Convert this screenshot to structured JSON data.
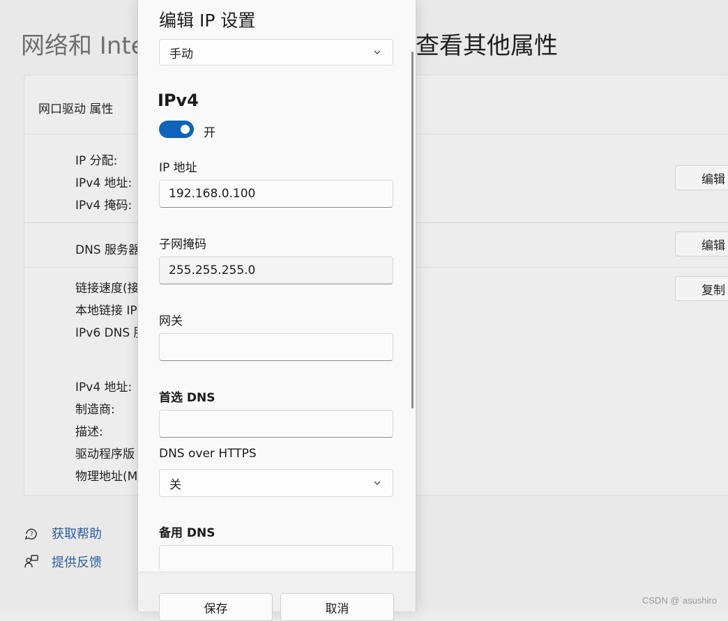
{
  "background": {
    "title_left": "网络和 Inte",
    "title_right": "查看其他属性",
    "card_header": "网口驱动 属性",
    "labels": {
      "ip_assign": "IP 分配:",
      "ipv4_addr": "IPv4 地址:",
      "ipv4_mask": "IPv4 掩码:",
      "dns": "DNS 服务器",
      "link_speed": "链接速度(接",
      "local_link": "本地链接 IP",
      "ipv6_dns": "IPv6 DNS 服",
      "ipv4_addr2": "IPv4 地址:",
      "manufacturer": "制造商:",
      "description": "描述:",
      "driver": "驱动程序版",
      "mac": "物理地址(M"
    },
    "buttons": {
      "edit1": "编辑",
      "edit2": "编辑",
      "copy": "复制"
    },
    "help_link": "获取帮助",
    "feedback_link": "提供反馈",
    "watermark": "CSDN @˙asushiro"
  },
  "dialog": {
    "title": "编辑 IP 设置",
    "mode_select": "手动",
    "ipv4_heading": "IPv4",
    "toggle_label": "开",
    "ip_label": "IP 地址",
    "ip_value": "192.168.0.100",
    "mask_label": "子网掩码",
    "mask_value": "255.255.255.0",
    "gateway_label": "网关",
    "gateway_value": "",
    "preferred_dns_label": "首选 DNS",
    "preferred_dns_value": "",
    "doh_label": "DNS over HTTPS",
    "doh_value": "关",
    "alt_dns_label": "备用 DNS",
    "save": "保存",
    "cancel": "取消"
  },
  "colors": {
    "accent": "#0f63b8",
    "link": "#2b5f9e"
  }
}
